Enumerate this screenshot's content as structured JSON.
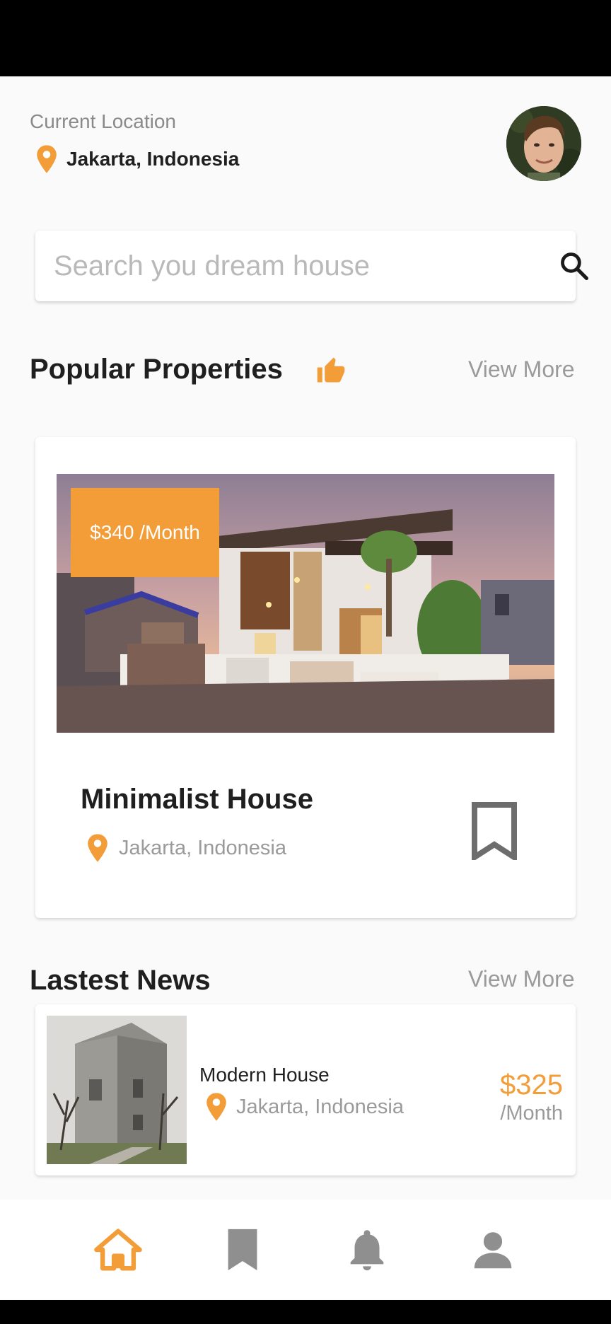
{
  "colors": {
    "accent": "#f29d38",
    "muted": "#9a9a9a",
    "icon_gray": "#8f8f8f",
    "text": "#1f1f1f"
  },
  "header": {
    "location_caption": "Current Location",
    "location": "Jakarta, Indonesia",
    "avatar_icon": "user-avatar-photo"
  },
  "search": {
    "placeholder": "Search you dream house",
    "value": "",
    "icon": "search-icon"
  },
  "popular": {
    "title": "Popular Properties",
    "title_icon": "thumbs-up-icon",
    "view_more": "View More",
    "card": {
      "price": "$340 /Month",
      "name": "Minimalist House",
      "location": "Jakarta, Indonesia",
      "bookmark_icon": "bookmark-outline-icon"
    }
  },
  "news": {
    "title": "Lastest News",
    "view_more": "View More",
    "item": {
      "name": "Modern House",
      "location": "Jakarta, Indonesia",
      "price": "$325",
      "period": "/Month"
    }
  },
  "bottom_nav": {
    "items": [
      {
        "icon": "home-icon",
        "active": true
      },
      {
        "icon": "bookmark-icon",
        "active": false
      },
      {
        "icon": "bell-icon",
        "active": false
      },
      {
        "icon": "person-icon",
        "active": false
      }
    ]
  }
}
